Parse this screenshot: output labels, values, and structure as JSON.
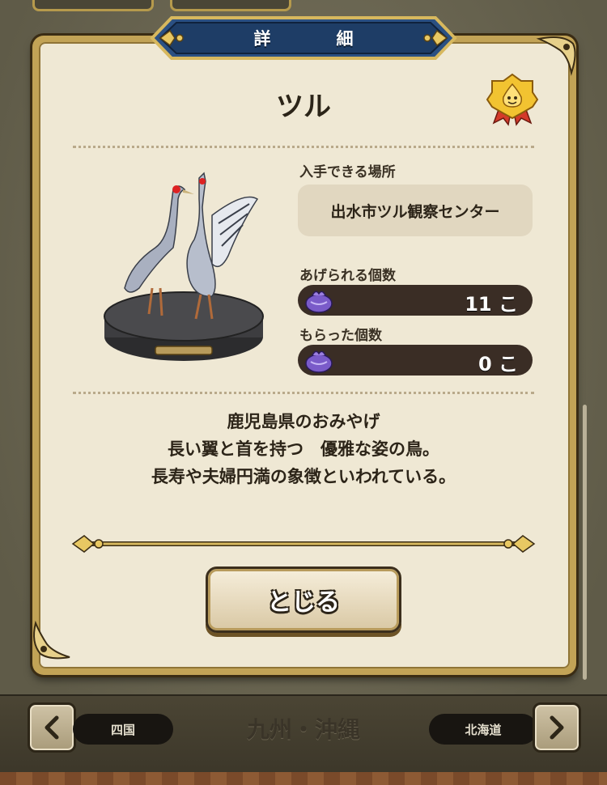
{
  "dialog": {
    "title": "詳　細",
    "item_name": "ツル",
    "location_label": "入手できる場所",
    "location_value": "出水市ツル観察センター",
    "giftable_label": "あげられる個数",
    "giftable_count": "11 こ",
    "received_label": "もらった個数",
    "received_count": "0 こ",
    "description": [
      "鹿児島県のおみやげ",
      "長い翼と首を持つ　優雅な姿の鳥。",
      "長寿や夫婦円満の象徴といわれている。"
    ],
    "close_label": "とじる"
  },
  "footer": {
    "prev_label": "四国",
    "current_region": "九州・沖縄",
    "next_label": "北海道"
  },
  "icons": {
    "prev": "chevron-left-icon",
    "next": "chevron-right-icon",
    "bag": "gift-bag-icon",
    "medal": "slime-medal-icon"
  },
  "colors": {
    "banner": "#1e3d66",
    "frame_gold": "#c2a356",
    "panel_bg": "#efe8d4",
    "count_bar": "#3a2d25"
  }
}
